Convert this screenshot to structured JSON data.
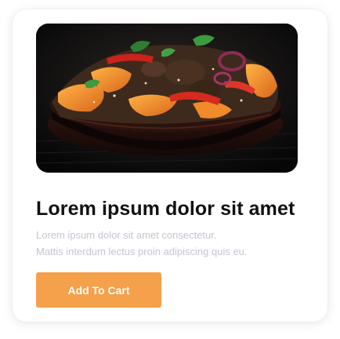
{
  "product": {
    "image_alt": "Bowl of stir-fried vegetables with sweet potato and red onion",
    "title": "Lorem ipsum dolor sit amet",
    "description_lines": [
      "Lorem ipsum dolor sit amet consectetur.",
      "Mattis interdum lectus proin adipiscing quis eu."
    ],
    "add_to_cart_label": "Add To Cart"
  },
  "colors": {
    "accent": "#f5a04a",
    "title": "#111111",
    "muted_text": "#c3c6cf",
    "card_bg": "#ffffff"
  }
}
